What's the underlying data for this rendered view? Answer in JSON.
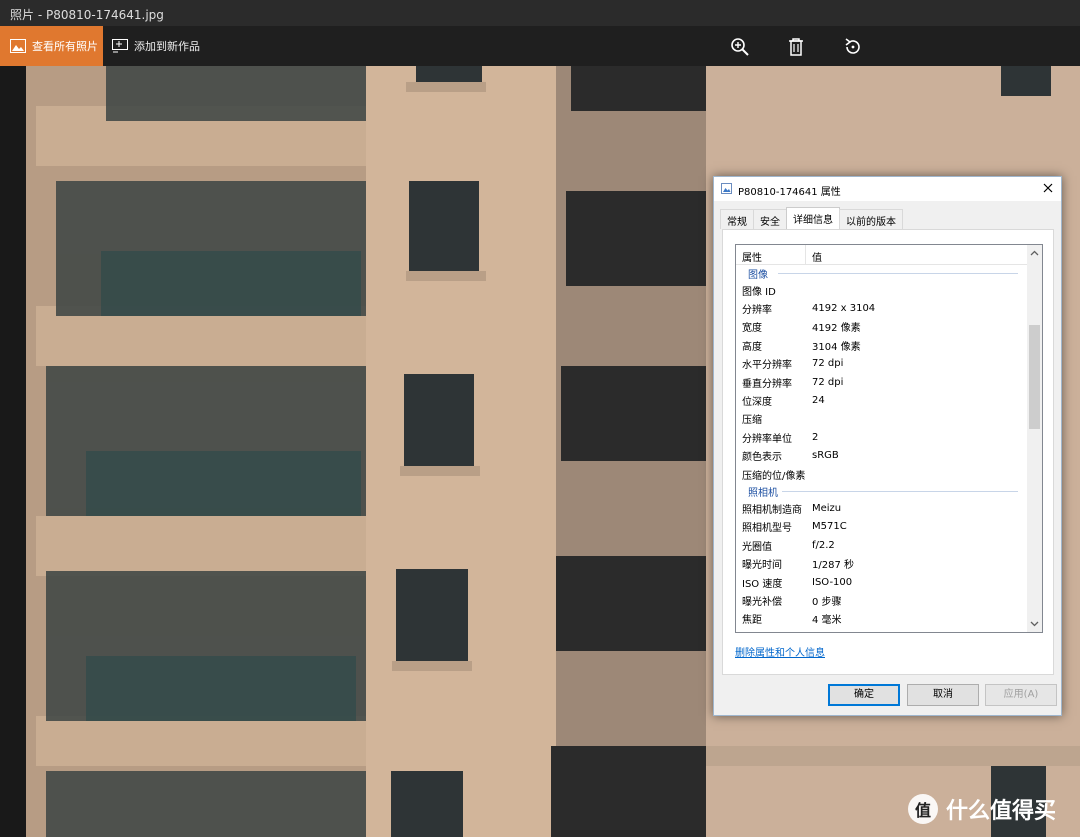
{
  "window": {
    "title": "照片 - P80810-174641.jpg"
  },
  "toolbar": {
    "view_all_label": "查看所有照片",
    "add_to_creation_label": "添加到新作品",
    "icons": [
      "zoom-in-icon",
      "delete-icon",
      "rotate-icon"
    ],
    "accent_color": "#e0782f"
  },
  "dialog": {
    "title": "P80810-174641 属性",
    "tabs": [
      {
        "label": "常规"
      },
      {
        "label": "安全"
      },
      {
        "label": "详细信息"
      },
      {
        "label": "以前的版本"
      }
    ],
    "active_tab": "详细信息",
    "columns": {
      "property": "属性",
      "value": "值"
    },
    "groups": [
      {
        "name": "图像",
        "rows": [
          {
            "k": "图像 ID",
            "v": ""
          },
          {
            "k": "分辨率",
            "v": "4192 x 3104"
          },
          {
            "k": "宽度",
            "v": "4192 像素"
          },
          {
            "k": "高度",
            "v": "3104 像素"
          },
          {
            "k": "水平分辨率",
            "v": "72 dpi"
          },
          {
            "k": "垂直分辨率",
            "v": "72 dpi"
          },
          {
            "k": "位深度",
            "v": "24"
          },
          {
            "k": "压缩",
            "v": ""
          },
          {
            "k": "分辨率单位",
            "v": "2"
          },
          {
            "k": "颜色表示",
            "v": "sRGB"
          },
          {
            "k": "压缩的位/像素",
            "v": ""
          }
        ]
      },
      {
        "name": "照相机",
        "rows": [
          {
            "k": "照相机制造商",
            "v": "Meizu"
          },
          {
            "k": "照相机型号",
            "v": "M571C"
          },
          {
            "k": "光圈值",
            "v": "f/2.2"
          },
          {
            "k": "曝光时间",
            "v": "1/287 秒"
          },
          {
            "k": "ISO 速度",
            "v": "ISO-100"
          },
          {
            "k": "曝光补偿",
            "v": "0 步骤"
          },
          {
            "k": "焦距",
            "v": "4 毫米"
          }
        ]
      }
    ],
    "remove_link": "删除属性和个人信息",
    "buttons": {
      "ok": "确定",
      "cancel": "取消",
      "apply": "应用(A)"
    }
  },
  "watermark": {
    "text": "什么值得买",
    "badge": "值"
  }
}
